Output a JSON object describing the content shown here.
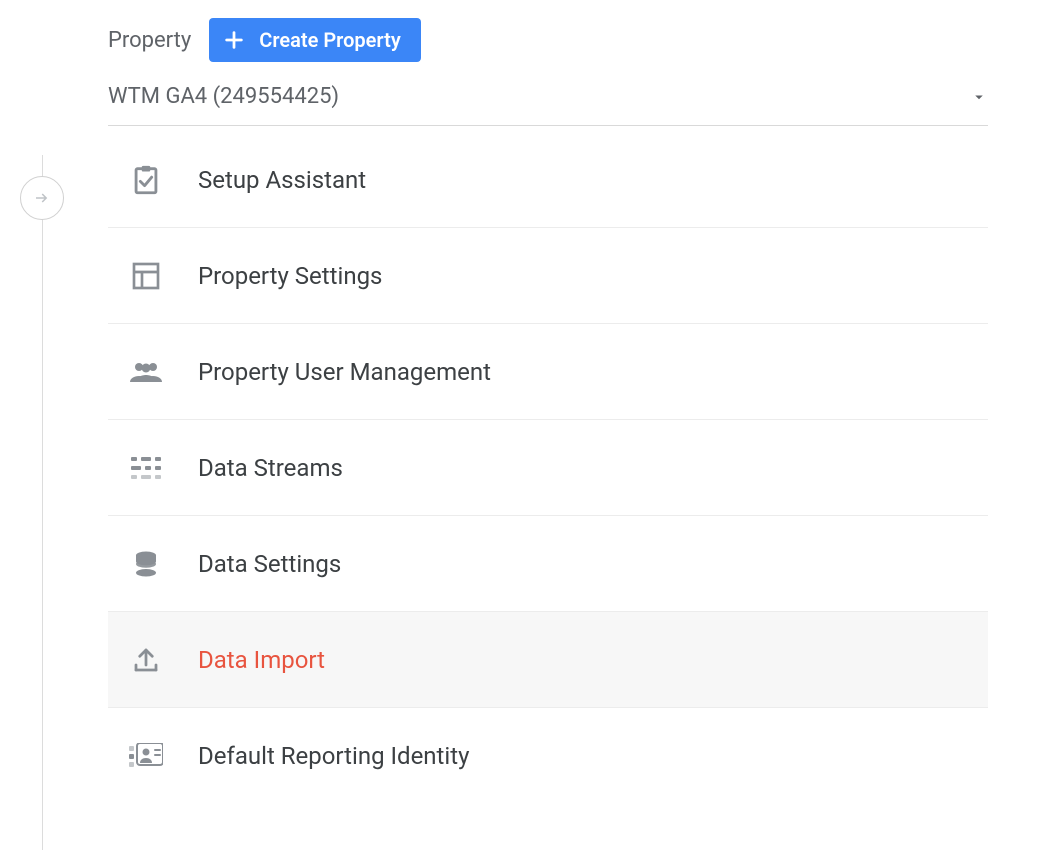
{
  "header": {
    "section_label": "Property",
    "create_button_label": "Create Property",
    "selected_property": "WTM GA4 (249554425)"
  },
  "nav": {
    "items": [
      {
        "label": "Setup Assistant",
        "icon": "clipboard-check-icon",
        "active": false
      },
      {
        "label": "Property Settings",
        "icon": "grid-icon",
        "active": false
      },
      {
        "label": "Property User Management",
        "icon": "users-icon",
        "active": false
      },
      {
        "label": "Data Streams",
        "icon": "flow-icon",
        "active": false
      },
      {
        "label": "Data Settings",
        "icon": "database-icon",
        "active": false
      },
      {
        "label": "Data Import",
        "icon": "upload-icon",
        "active": true
      },
      {
        "label": "Default Reporting Identity",
        "icon": "identity-icon",
        "active": false
      }
    ]
  }
}
